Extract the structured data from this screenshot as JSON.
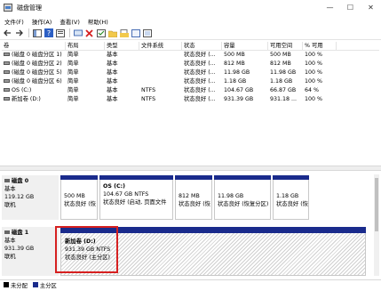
{
  "window": {
    "title": "磁盘管理",
    "minimize": "—",
    "maximize": "☐",
    "close": "✕"
  },
  "menu": [
    "文件(F)",
    "操作(A)",
    "查看(V)",
    "帮助(H)"
  ],
  "toolbar": {
    "icons": [
      "back-arrow-icon",
      "forward-arrow-icon",
      "console-tree-icon",
      "help-icon",
      "properties-icon",
      "connect-icon",
      "delete-icon",
      "check-icon",
      "new-folder-icon",
      "open-folder-icon",
      "extend-icon",
      "view-icon"
    ]
  },
  "volume_table": {
    "headers": [
      "卷",
      "布局",
      "类型",
      "文件系统",
      "状态",
      "容量",
      "可用空间",
      "% 可用"
    ],
    "rows": [
      {
        "vol": "(磁盘 0 磁盘分区 1)",
        "layout": "简单",
        "type": "基本",
        "fs": "",
        "status": "状态良好 (...",
        "cap": "500 MB",
        "free": "500 MB",
        "pct": "100 %"
      },
      {
        "vol": "(磁盘 0 磁盘分区 2)",
        "layout": "简单",
        "type": "基本",
        "fs": "",
        "status": "状态良好 (...",
        "cap": "812 MB",
        "free": "812 MB",
        "pct": "100 %"
      },
      {
        "vol": "(磁盘 0 磁盘分区 5)",
        "layout": "简单",
        "type": "基本",
        "fs": "",
        "status": "状态良好 (...",
        "cap": "11.98 GB",
        "free": "11.98 GB",
        "pct": "100 %"
      },
      {
        "vol": "(磁盘 0 磁盘分区 6)",
        "layout": "简单",
        "type": "基本",
        "fs": "",
        "status": "状态良好 (...",
        "cap": "1.18 GB",
        "free": "1.18 GB",
        "pct": "100 %"
      },
      {
        "vol": "OS (C:)",
        "layout": "简单",
        "type": "基本",
        "fs": "NTFS",
        "status": "状态良好 (...",
        "cap": "104.67 GB",
        "free": "66.87 GB",
        "pct": "64 %"
      },
      {
        "vol": "新加卷 (D:)",
        "layout": "简单",
        "type": "基本",
        "fs": "NTFS",
        "status": "状态良好 (...",
        "cap": "931.39 GB",
        "free": "931.18 ...",
        "pct": "100 %"
      }
    ]
  },
  "disks": [
    {
      "name": "磁盘 0",
      "type": "基本",
      "size": "119.12 GB",
      "state": "联机",
      "partitions": [
        {
          "name": "",
          "size": "500 MB",
          "status": "状态良好 (恢"
        },
        {
          "name": "OS  (C:)",
          "size": "104.67 GB NTFS",
          "status": "状态良好 (启动, 页面文件"
        },
        {
          "name": "",
          "size": "812 MB",
          "status": "状态良好 (恢"
        },
        {
          "name": "",
          "size": "11.98 GB",
          "status": "状态良好 (恢复分区)"
        },
        {
          "name": "",
          "size": "1.18 GB",
          "status": "状态良好 (恢"
        }
      ]
    },
    {
      "name": "磁盘 1",
      "type": "基本",
      "size": "931.39 GB",
      "state": "联机",
      "partitions": [
        {
          "name": "新加卷  (D:)",
          "size": "931.39 GB NTFS",
          "status": "状态良好 (主分区)"
        }
      ]
    }
  ],
  "legend": [
    {
      "label": "未分配",
      "color": "#000000"
    },
    {
      "label": "主分区",
      "color": "#1a2b8c"
    }
  ],
  "colors": {
    "primary_partition": "#1a2b8c",
    "highlight": "#d62020"
  }
}
